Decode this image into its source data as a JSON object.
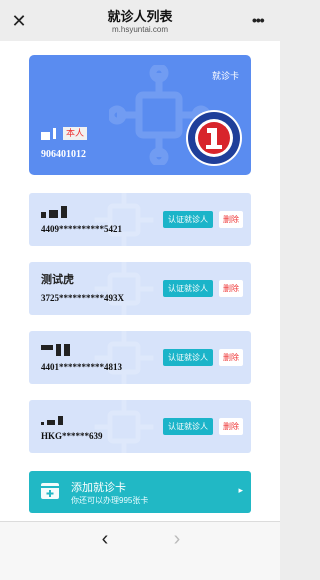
{
  "header": {
    "title": "就诊人列表",
    "subtitle": "m.hsyuntai.com",
    "close_icon": "close-icon",
    "more_icon": "more-icon",
    "more_glyph": "•••"
  },
  "main_card": {
    "card_type": "就诊卡",
    "badge": "本人",
    "id_number": "906401012",
    "color": "#5a8cf0"
  },
  "patients": [
    {
      "name": "",
      "id_number": "4409**********5421",
      "verify_label": "认证就诊人",
      "delete_label": "删除"
    },
    {
      "name": "测试虎",
      "id_number": "3725**********493X",
      "verify_label": "认证就诊人",
      "delete_label": "删除"
    },
    {
      "name": "",
      "id_number": "4401**********4813",
      "verify_label": "认证就诊人",
      "delete_label": "删除"
    },
    {
      "name": "",
      "id_number": "HKG******639",
      "verify_label": "认证就诊人",
      "delete_label": "删除"
    }
  ],
  "add_card": {
    "title": "添加就诊卡",
    "subtitle": "你还可以办理995张卡",
    "arrow": "▸",
    "color": "#21b8c5"
  },
  "nav": {
    "back": "‹",
    "forward": "›"
  }
}
